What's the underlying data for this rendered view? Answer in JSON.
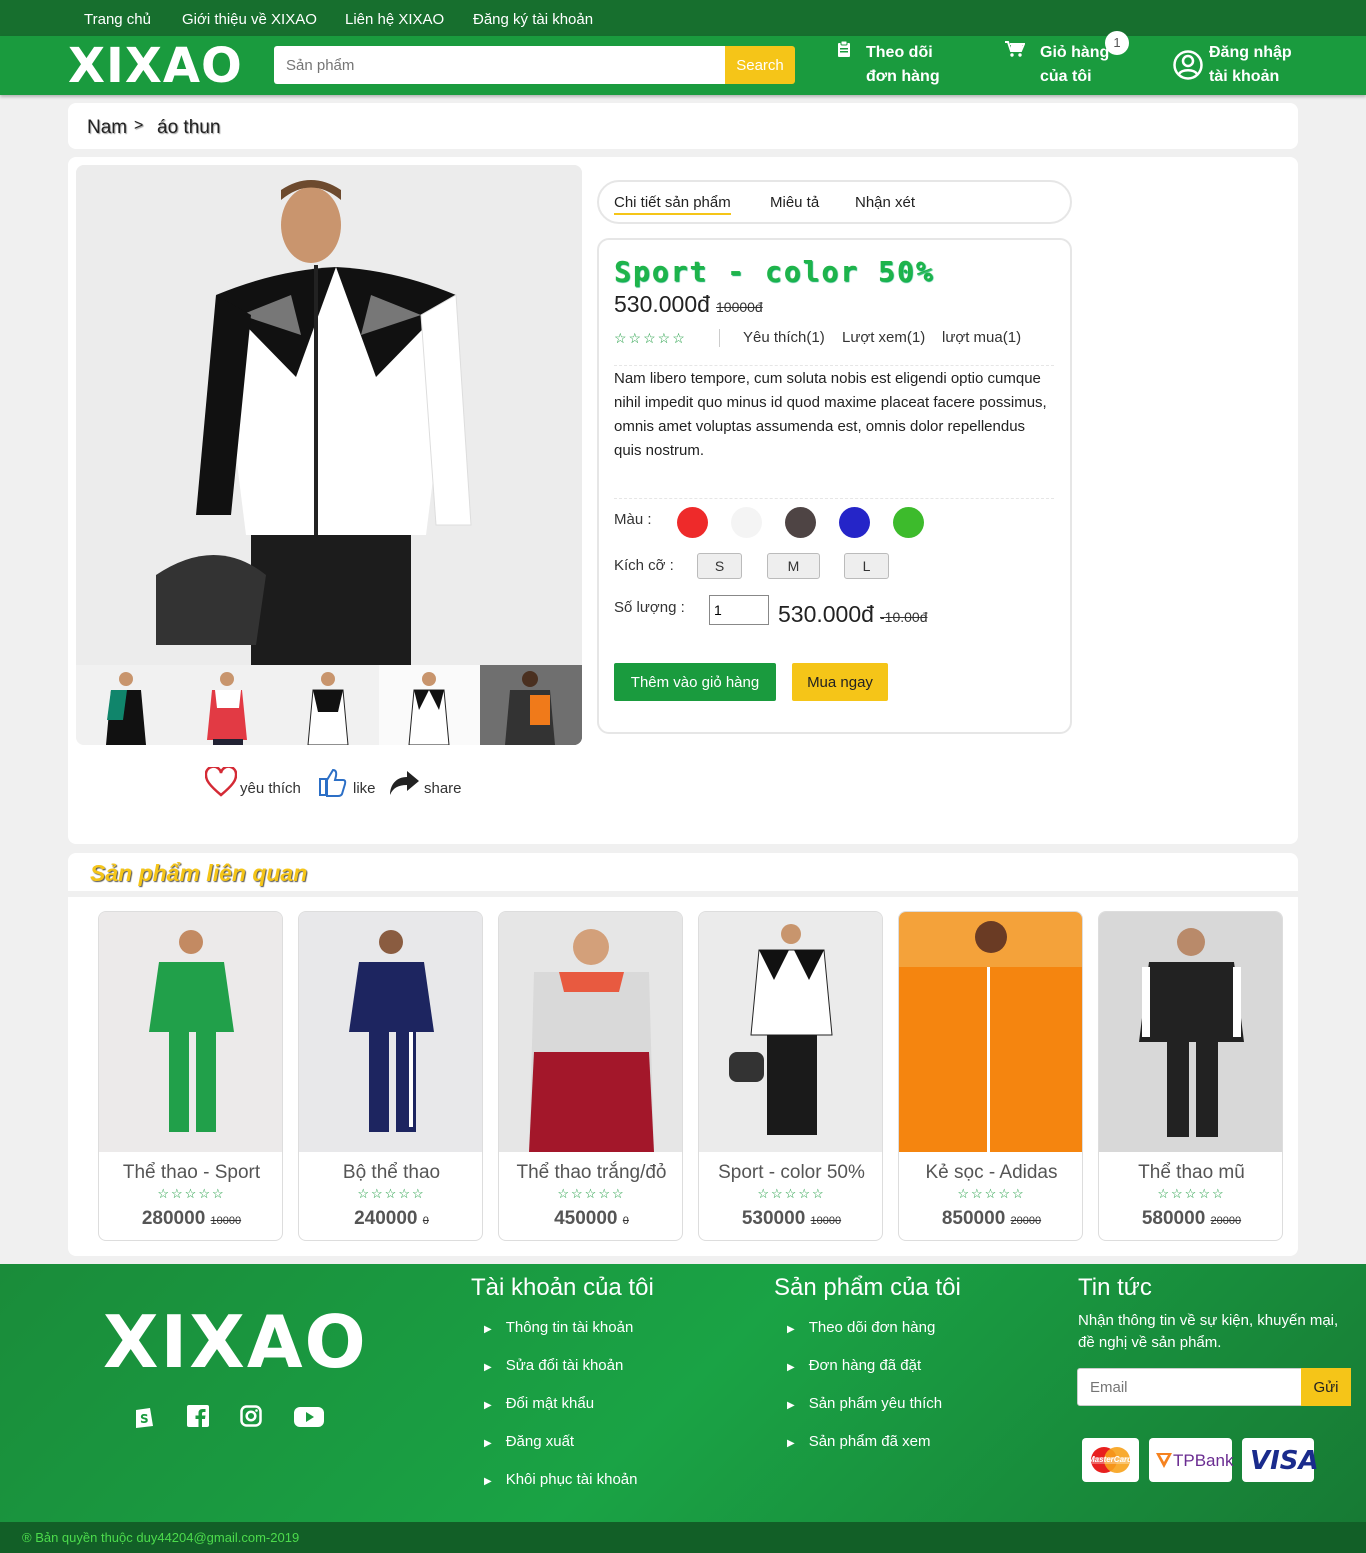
{
  "topnav": [
    "Trang chủ",
    "Giới thiệu về XIXAO",
    "Liên hệ XIXAO",
    "Đăng ký tài khoản"
  ],
  "header": {
    "logo": "XIXAO",
    "search_placeholder": "Sản phẩm",
    "search_button": "Search",
    "track_order": [
      "Theo dõi",
      "đơn hàng"
    ],
    "cart": [
      "Giỏ hàng",
      "của tôi"
    ],
    "cart_count": "1",
    "login": [
      "Đăng nhập",
      "tài khoản"
    ]
  },
  "breadcrumb": [
    "Nam",
    "áo thun"
  ],
  "tabs": [
    "Chi tiết sản phẩm",
    "Miêu tả",
    "Nhận xét"
  ],
  "product": {
    "title": "Sport - color 50%",
    "price": "530.000đ",
    "old_price": "10000đ",
    "rating": "☆☆☆☆☆",
    "likes": "Yêu thích(1)",
    "views": "Lượt xem(1)",
    "buys": "lượt mua(1)",
    "description": "Nam libero tempore, cum soluta nobis est eligendi optio cumque nihil impedit quo minus id quod maxime placeat facere possimus, omnis amet voluptas assumenda est, omnis dolor repellendus quis nostrum.",
    "color_label": "Màu :",
    "colors": [
      "#ee2a2a",
      "#f4f4f4",
      "#4e4444",
      "#2525c8",
      "#3dbb2c"
    ],
    "size_label": "Kích cỡ :",
    "sizes": [
      "S",
      "M",
      "L"
    ],
    "qty_label": "Số lượng :",
    "qty_value": "1",
    "total": "530.000đ",
    "total_old": "-10.00đ",
    "add_to_cart": "Thêm vào giỏ hàng",
    "buy_now": "Mua ngay"
  },
  "social": {
    "like_heart": "yêu thích",
    "like": "like",
    "share": "share"
  },
  "related": {
    "title": "Sản phẩm liên quan",
    "items": [
      {
        "name": "Thể thao - Sport",
        "price": "280000",
        "old": "10000",
        "rating": "☆☆☆☆☆"
      },
      {
        "name": "Bộ thể thao",
        "price": "240000",
        "old": "0",
        "rating": "☆☆☆☆☆"
      },
      {
        "name": "Thể thao trắng/đỏ",
        "price": "450000",
        "old": "0",
        "rating": "☆☆☆☆☆"
      },
      {
        "name": "Sport - color 50%",
        "price": "530000",
        "old": "10000",
        "rating": "☆☆☆☆☆"
      },
      {
        "name": "Kẻ sọc - Adidas",
        "price": "850000",
        "old": "20000",
        "rating": "☆☆☆☆☆"
      },
      {
        "name": "Thể thao mũ",
        "price": "580000",
        "old": "20000",
        "rating": "☆☆☆☆☆"
      }
    ]
  },
  "footer": {
    "logo": "XIXAO",
    "account_title": "Tài khoản của tôi",
    "account_links": [
      "Thông tin tài khoản",
      "Sửa đổi tài khoản",
      "Đổi mật khẩu",
      "Đăng xuất",
      "Khôi phục tài khoản"
    ],
    "product_title": "Sản phẩm của tôi",
    "product_links": [
      "Theo dõi đơn hàng",
      "Đơn hàng đã đặt",
      "Sản phẩm yêu thích",
      "Sản phẩm đã xem"
    ],
    "news_title": "Tin tức",
    "news_text": "Nhận thông tin về sự kiện, khuyến mại, đề nghị về sản phẩm.",
    "email_placeholder": "Email",
    "send": "Gửi",
    "payments": [
      "MasterCard",
      "TPBank",
      "VISA"
    ],
    "copyright": "® Bản quyền thuộc duy44204@gmail.com-2019"
  }
}
